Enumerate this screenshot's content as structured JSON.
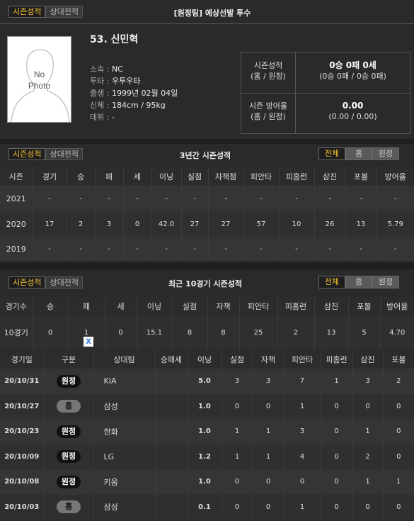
{
  "header": {
    "tabs": [
      {
        "label": "시즌성적",
        "active": true
      },
      {
        "label": "상대전적",
        "active": false
      }
    ],
    "title": "[원정팀] 예상선발 투수"
  },
  "profile": {
    "name": "53. 신민혁",
    "photo_text": [
      "No",
      "Photo"
    ],
    "info": [
      {
        "label": "소속 :",
        "value": "NC"
      },
      {
        "label": "투타 :",
        "value": "우투우타"
      },
      {
        "label": "출생 :",
        "value": "1999년 02월 04일"
      },
      {
        "label": "신체 :",
        "value": "184cm / 95kg"
      },
      {
        "label": "데뷔 :",
        "value": "-"
      }
    ],
    "season_record": {
      "label1": "시즌성적",
      "label2": "(홈 / 원정)",
      "value": "0승 0패 0세",
      "sub": "(0승 0패 / 0승 0패)"
    },
    "season_era": {
      "label1": "시즌 방어율",
      "label2": "(홈 / 원정)",
      "value": "0.00",
      "sub": "(0.00 / 0.00)"
    }
  },
  "three_year": {
    "tabs": [
      {
        "label": "시즌성적",
        "active": true
      },
      {
        "label": "상대전적",
        "active": false
      }
    ],
    "title": "3년간 시즌성적",
    "filters": [
      {
        "label": "전체",
        "active": true
      },
      {
        "label": "홈",
        "active": false
      },
      {
        "label": "원정",
        "active": false
      }
    ],
    "columns": [
      "시즌",
      "경기",
      "승",
      "패",
      "세",
      "이닝",
      "실점",
      "자책점",
      "피안타",
      "피홈런",
      "삼진",
      "포볼",
      "방어율"
    ],
    "rows": [
      [
        "2021",
        "-",
        "-",
        "-",
        "-",
        "-",
        "-",
        "-",
        "-",
        "-",
        "-",
        "-",
        "-"
      ],
      [
        "2020",
        "17",
        "2",
        "3",
        "0",
        "42.0",
        "27",
        "27",
        "57",
        "10",
        "26",
        "13",
        "5.79"
      ],
      [
        "2019",
        "-",
        "-",
        "-",
        "-",
        "-",
        "-",
        "-",
        "-",
        "-",
        "-",
        "-",
        "-"
      ]
    ]
  },
  "recent": {
    "tabs": [
      {
        "label": "시즌성적",
        "active": true
      },
      {
        "label": "상대전적",
        "active": false
      }
    ],
    "title": "최근 10경기 시즌성적",
    "filters": [
      {
        "label": "전체",
        "active": true
      },
      {
        "label": "홈",
        "active": false
      },
      {
        "label": "원정",
        "active": false
      }
    ],
    "summary_columns": [
      "경기수",
      "승",
      "패",
      "세",
      "이닝",
      "실점",
      "자책",
      "피안타",
      "피홈런",
      "삼진",
      "포볼",
      "방어율"
    ],
    "summary_row": [
      "10경기",
      "0",
      "1",
      "0",
      "15.1",
      "8",
      "8",
      "25",
      "2",
      "13",
      "5",
      "4.70"
    ],
    "x_mark": "X",
    "game_columns": [
      "경기일",
      "구분",
      "상대팀",
      "승패세",
      "이닝",
      "실점",
      "자책",
      "피안타",
      "피홈런",
      "삼진",
      "포볼"
    ],
    "games": [
      {
        "date": "20/10/31",
        "type": "원정",
        "away": true,
        "opp": "KIA",
        "res": "",
        "ip": "5.0",
        "r": "3",
        "er": "3",
        "h": "7",
        "hr": "1",
        "so": "3",
        "bb": "2"
      },
      {
        "date": "20/10/27",
        "type": "홈",
        "away": false,
        "opp": "삼성",
        "res": "",
        "ip": "1.0",
        "r": "0",
        "er": "0",
        "h": "1",
        "hr": "0",
        "so": "0",
        "bb": "0"
      },
      {
        "date": "20/10/23",
        "type": "원정",
        "away": true,
        "opp": "한화",
        "res": "",
        "ip": "1.0",
        "r": "1",
        "er": "1",
        "h": "3",
        "hr": "0",
        "so": "1",
        "bb": "0"
      },
      {
        "date": "20/10/09",
        "type": "원정",
        "away": true,
        "opp": "LG",
        "res": "",
        "ip": "1.2",
        "r": "1",
        "er": "1",
        "h": "4",
        "hr": "0",
        "so": "2",
        "bb": "0"
      },
      {
        "date": "20/10/08",
        "type": "원정",
        "away": true,
        "opp": "키움",
        "res": "",
        "ip": "1.0",
        "r": "0",
        "er": "0",
        "h": "0",
        "hr": "0",
        "so": "1",
        "bb": "1"
      },
      {
        "date": "20/10/03",
        "type": "홈",
        "away": false,
        "opp": "삼성",
        "res": "",
        "ip": "0.1",
        "r": "0",
        "er": "0",
        "h": "1",
        "hr": "0",
        "so": "0",
        "bb": "0"
      }
    ]
  },
  "colors": {
    "accent": "#f2c230",
    "bg": "#2a2a2a",
    "row": "#353535"
  }
}
